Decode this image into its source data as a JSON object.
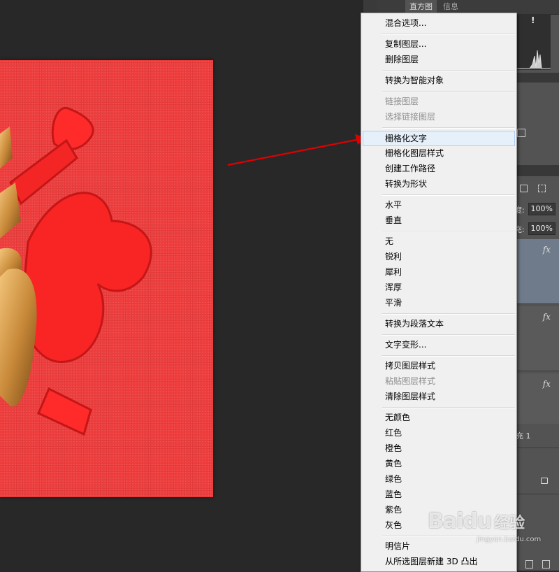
{
  "right_panel": {
    "tabs": [
      "直方图",
      "信息"
    ],
    "opacity_label": "度:",
    "opacity_value": "100%",
    "fill_label": "充:",
    "fill_value": "100%",
    "layer_name_fragment": "1",
    "fx_label": "fx",
    "warning_icon": "!"
  },
  "context_menu": {
    "items": [
      {
        "label": "混合选项..."
      },
      {
        "label": "复制图层..."
      },
      {
        "label": "删除图层"
      },
      {
        "label": "转换为智能对象"
      },
      {
        "label": "链接图层"
      },
      {
        "label": "选择链接图层"
      },
      {
        "label": "栅格化文字"
      },
      {
        "label": "栅格化图层样式"
      },
      {
        "label": "创建工作路径"
      },
      {
        "label": "转换为形状"
      },
      {
        "label": "水平"
      },
      {
        "label": "垂直"
      },
      {
        "label": "无"
      },
      {
        "label": "锐利"
      },
      {
        "label": "犀利"
      },
      {
        "label": "浑厚"
      },
      {
        "label": "平滑"
      },
      {
        "label": "转换为段落文本"
      },
      {
        "label": "文字变形..."
      },
      {
        "label": "拷贝图层样式"
      },
      {
        "label": "粘贴图层样式"
      },
      {
        "label": "清除图层样式"
      },
      {
        "label": "无颜色"
      },
      {
        "label": "红色"
      },
      {
        "label": "橙色"
      },
      {
        "label": "黄色"
      },
      {
        "label": "绿色"
      },
      {
        "label": "蓝色"
      },
      {
        "label": "紫色"
      },
      {
        "label": "灰色"
      },
      {
        "label": "明信片"
      },
      {
        "label": "从所选图层新建 3D 凸出"
      }
    ]
  },
  "watermark": {
    "brand": "Baidu",
    "suffix": "经验",
    "site": "jingyan.baidu.com"
  },
  "colors": {
    "canvas_red": "#ef3f3f",
    "arrow_red": "#e00000",
    "menu_bg": "#f0f0f0",
    "highlight": "#e6f0fa"
  }
}
